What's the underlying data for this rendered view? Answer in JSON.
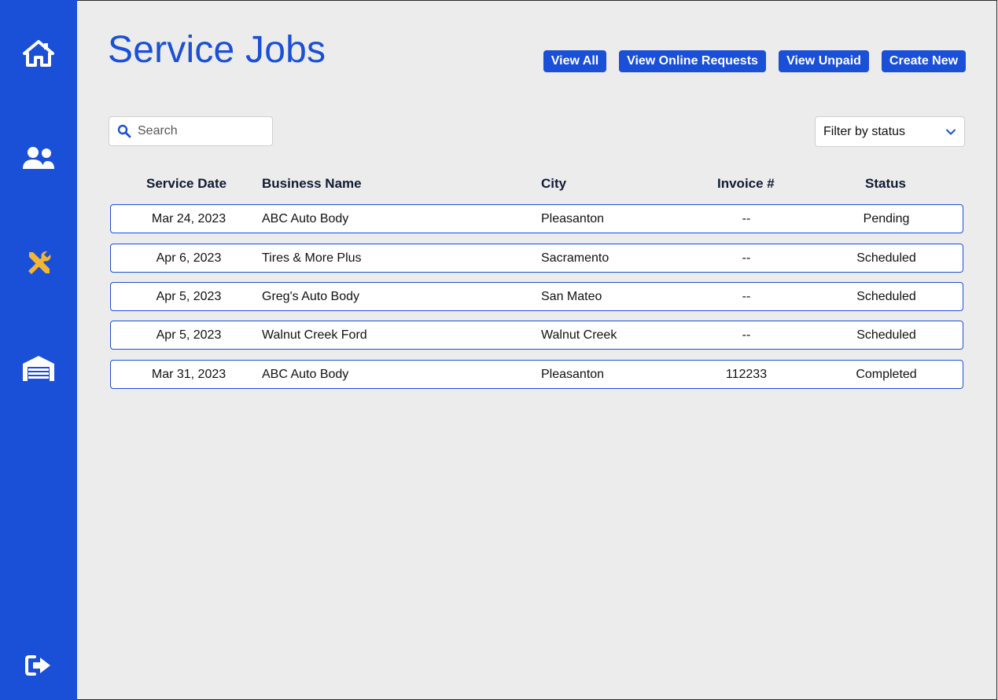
{
  "page": {
    "title": "Service Jobs"
  },
  "sidebar": {
    "items": [
      {
        "icon": "home-icon"
      },
      {
        "icon": "users-icon"
      },
      {
        "icon": "tools-icon"
      },
      {
        "icon": "garage-icon"
      }
    ],
    "logout_icon": "logout-icon"
  },
  "toolbar": {
    "view_all": "View All",
    "view_online_requests": "View Online Requests",
    "view_unpaid": "View Unpaid",
    "create_new": "Create New"
  },
  "search": {
    "placeholder": "Search",
    "value": ""
  },
  "filter": {
    "label": "Filter by status"
  },
  "table": {
    "headers": [
      "Service Date",
      "Business Name",
      "City",
      "Invoice #",
      "Status"
    ],
    "rows": [
      [
        "Mar 24, 2023",
        "ABC Auto Body",
        "Pleasanton",
        "--",
        "Pending"
      ],
      [
        "Apr 6, 2023",
        "Tires & More Plus",
        "Sacramento",
        "--",
        "Scheduled"
      ],
      [
        "Apr 5, 2023",
        "Greg's Auto Body",
        "San Mateo",
        "--",
        "Scheduled"
      ],
      [
        "Apr 5, 2023",
        "Walnut Creek Ford",
        "Walnut Creek",
        "--",
        "Scheduled"
      ],
      [
        "Mar 31, 2023",
        "ABC Auto Body",
        "Pleasanton",
        "112233",
        "Completed"
      ]
    ]
  },
  "colors": {
    "brand": "#1a4fd8",
    "active_icon": "#f2b632",
    "background": "#ececec"
  }
}
